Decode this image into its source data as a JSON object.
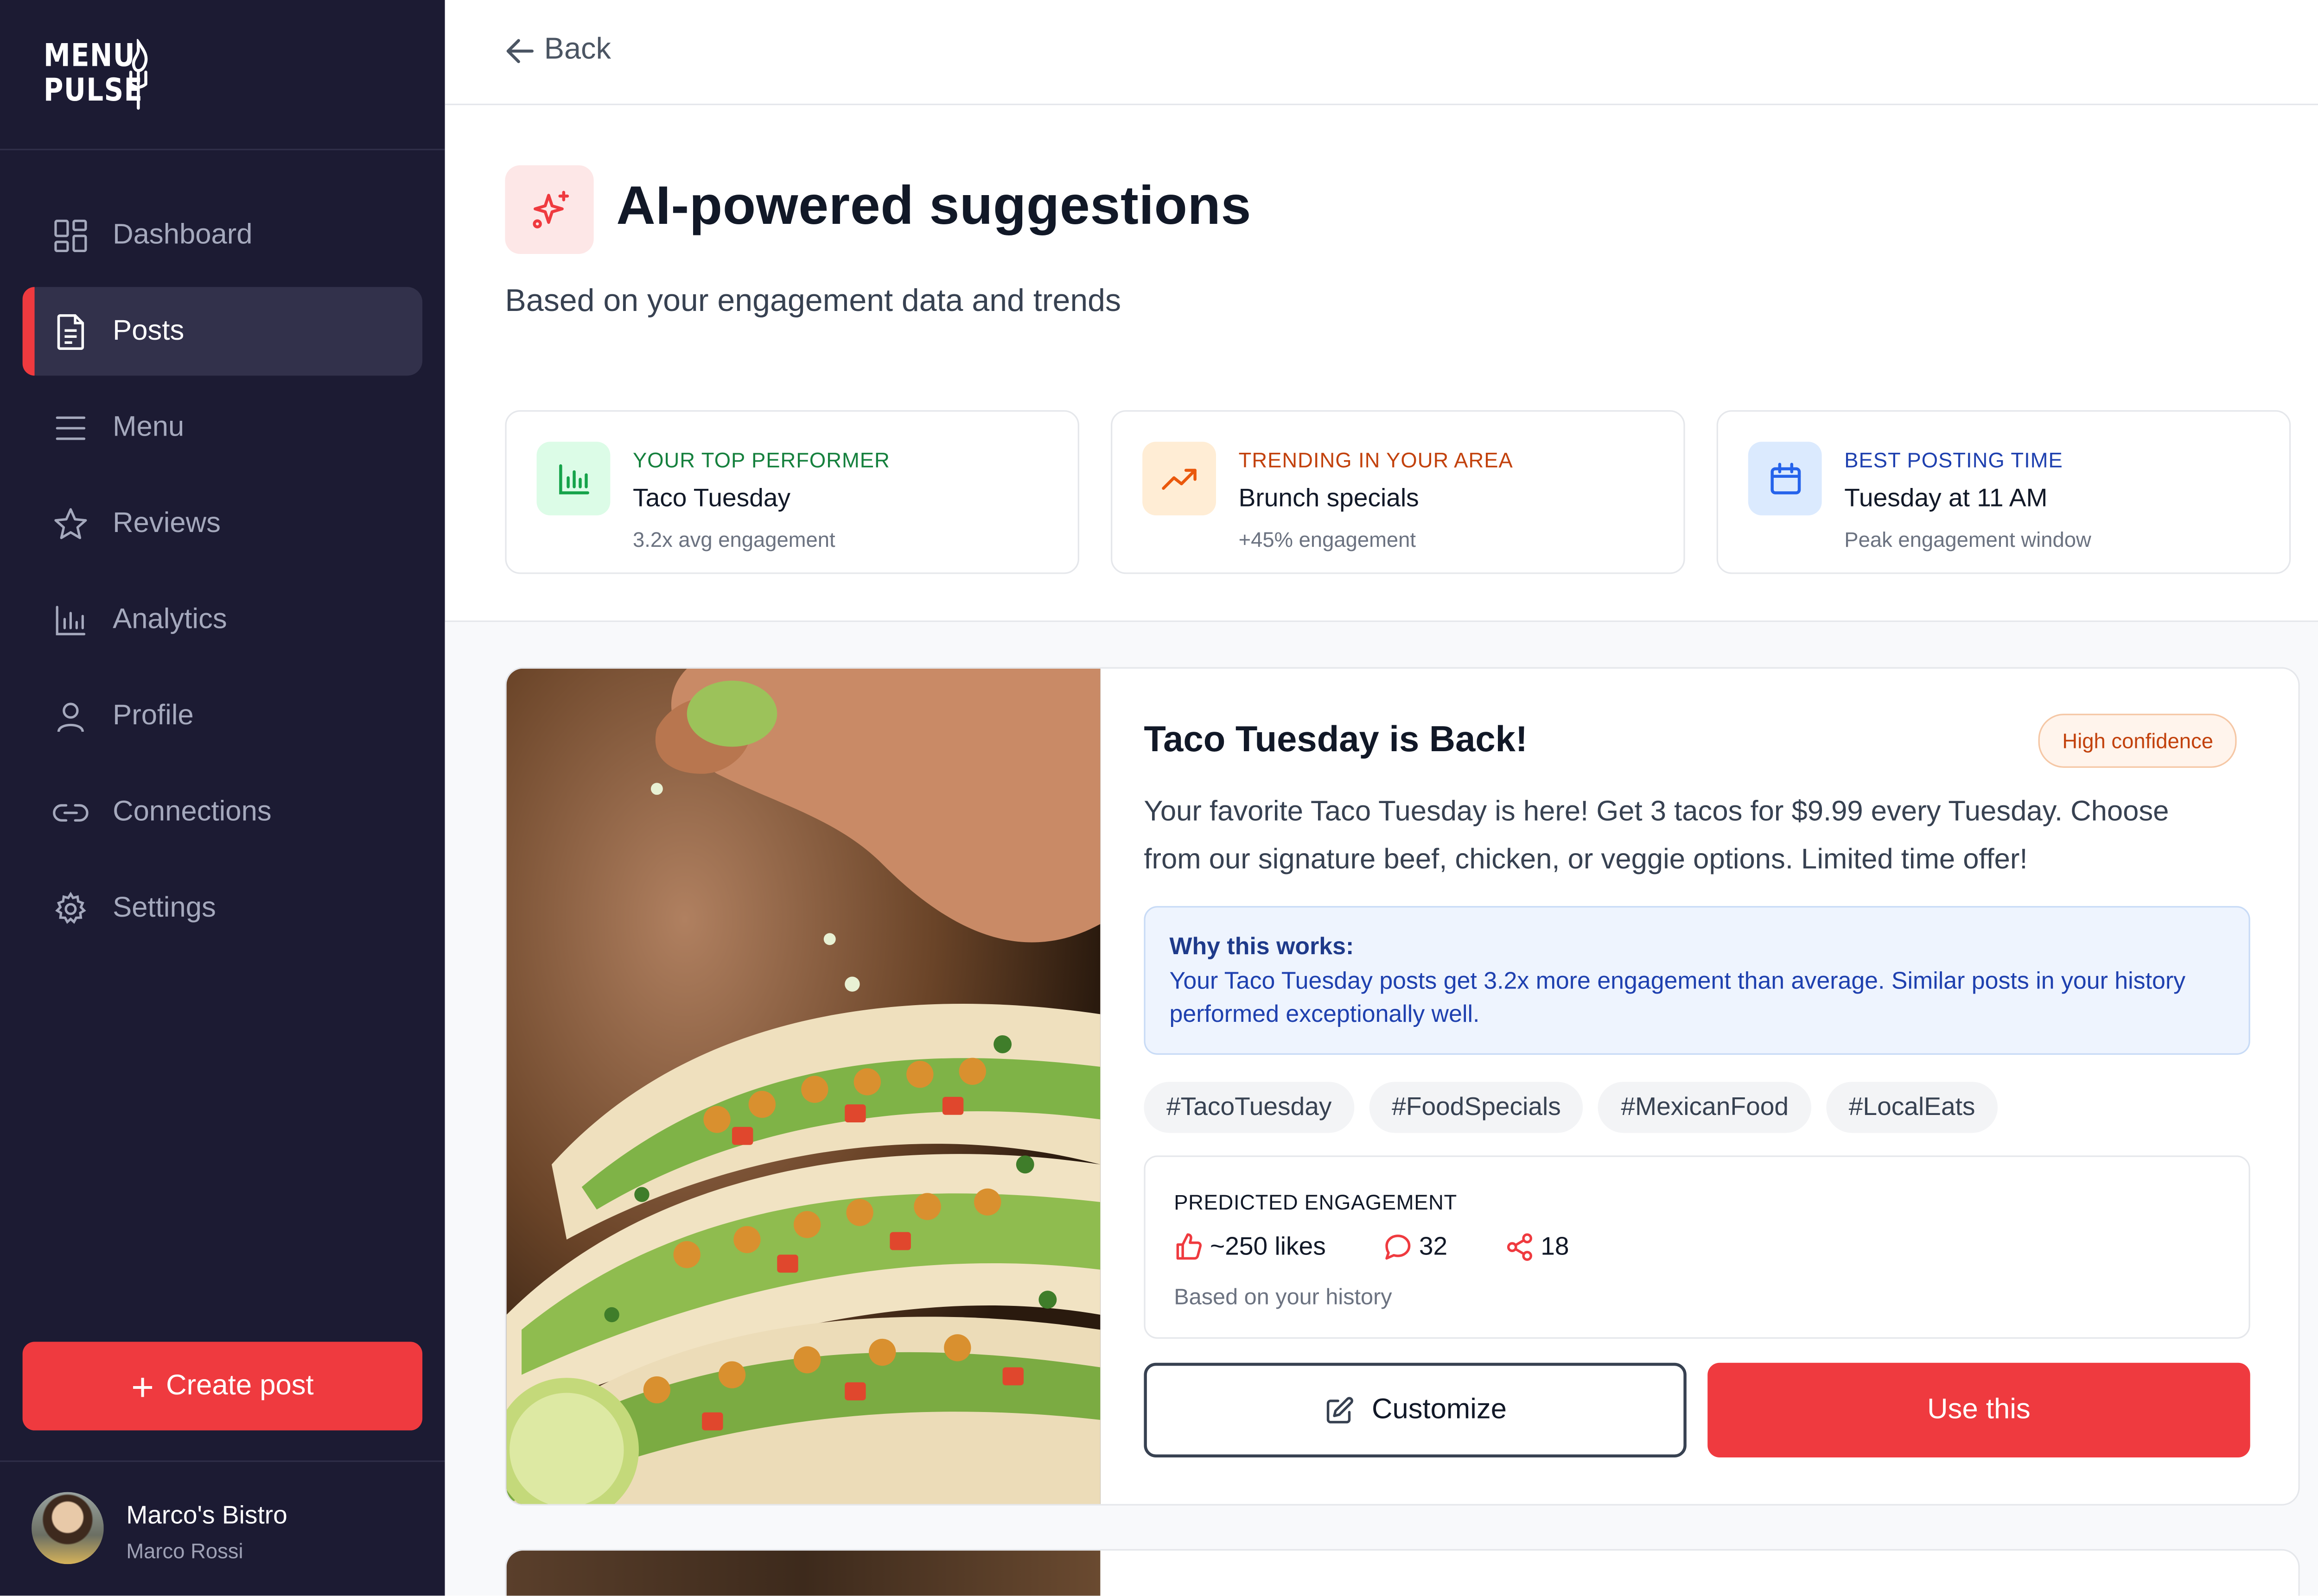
{
  "brand": {
    "line1": "MENU",
    "line2": "PULSE"
  },
  "nav": {
    "items": [
      {
        "label": "Dashboard",
        "icon": "dashboard-grid-icon",
        "active": false
      },
      {
        "label": "Posts",
        "icon": "document-icon",
        "active": true
      },
      {
        "label": "Menu",
        "icon": "menu-lines-icon",
        "active": false
      },
      {
        "label": "Reviews",
        "icon": "star-icon",
        "active": false
      },
      {
        "label": "Analytics",
        "icon": "bar-chart-icon",
        "active": false
      },
      {
        "label": "Profile",
        "icon": "user-icon",
        "active": false
      },
      {
        "label": "Connections",
        "icon": "link-icon",
        "active": false
      },
      {
        "label": "Settings",
        "icon": "gear-icon",
        "active": false
      }
    ]
  },
  "create_post": {
    "label": "Create post",
    "icon": "plus-icon"
  },
  "user": {
    "business": "Marco's Bistro",
    "name": "Marco Rossi"
  },
  "topbar": {
    "back_label": "Back"
  },
  "hero": {
    "title": "AI-powered suggestions",
    "subtitle": "Based on your engagement data and trends"
  },
  "insights": [
    {
      "label": "YOUR TOP PERFORMER",
      "title": "Taco Tuesday",
      "sub": "3.2x avg engagement",
      "icon": "bar-chart-icon",
      "color": "#15803d",
      "bg": "#dcfce7"
    },
    {
      "label": "TRENDING IN YOUR AREA",
      "title": "Brunch specials",
      "sub": "+45% engagement",
      "icon": "trending-up-icon",
      "color": "#c2410c",
      "bg": "#ffedd5"
    },
    {
      "label": "BEST POSTING TIME",
      "title": "Tuesday at 11 AM",
      "sub": "Peak engagement window",
      "icon": "calendar-icon",
      "color": "#1e40af",
      "bg": "#dbeafe"
    }
  ],
  "suggestion": {
    "title": "Taco Tuesday is Back!",
    "confidence": "High confidence",
    "description": "Your favorite Taco Tuesday is here! Get 3 tacos for $9.99 every Tuesday. Choose from our signature beef, chicken, or veggie options. Limited time offer!",
    "why_title": "Why this works:",
    "why_text": "Your Taco Tuesday posts get 3.2x more engagement than average. Similar posts in your history performed exceptionally well.",
    "tags": [
      "#TacoTuesday",
      "#FoodSpecials",
      "#MexicanFood",
      "#LocalEats"
    ],
    "predicted_label": "PREDICTED ENGAGEMENT",
    "likes": "~250 likes",
    "comments": "32",
    "shares": "18",
    "predicted_foot": "Based on your history",
    "customize_label": "Customize",
    "use_label": "Use this"
  },
  "colors": {
    "sidebar_bg": "#1c1b33",
    "accent": "#ef3a3f"
  }
}
